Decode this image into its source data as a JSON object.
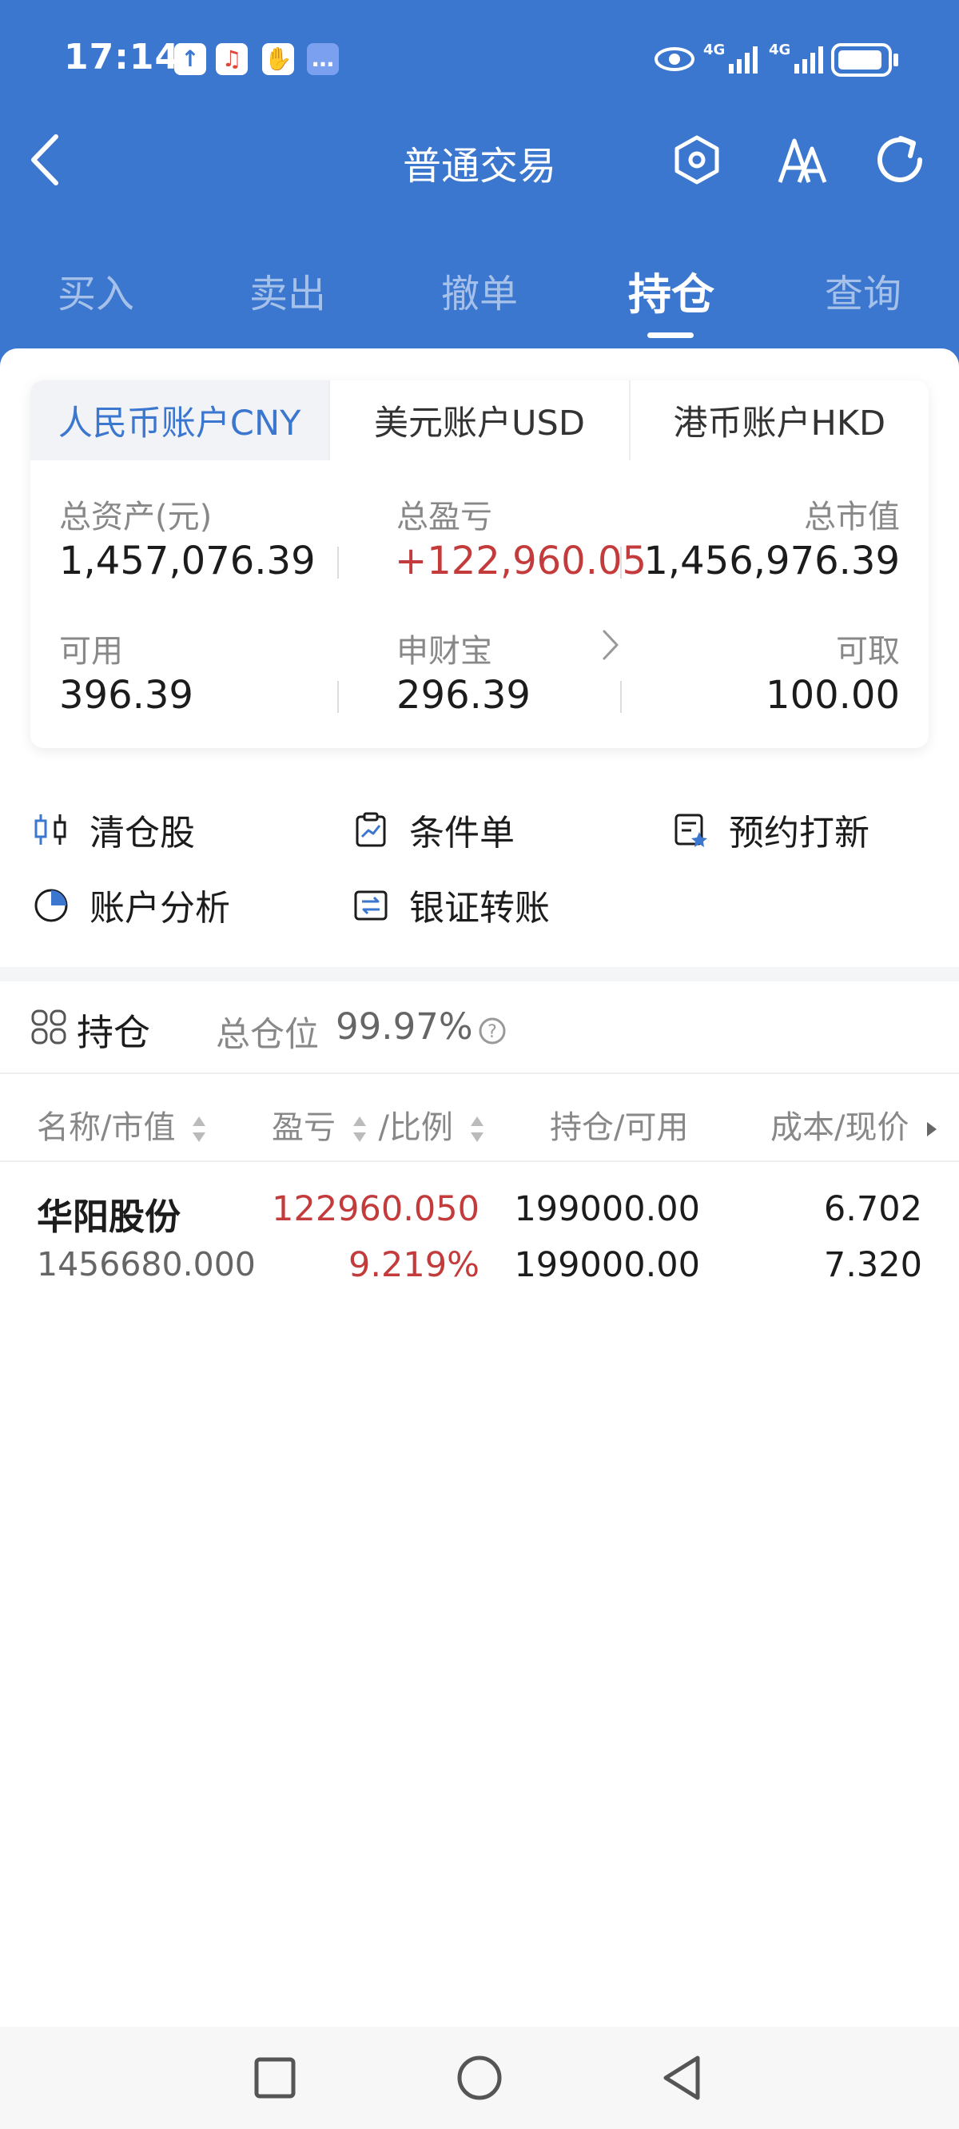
{
  "status_bar": {
    "time": "17:14"
  },
  "header": {
    "title": "普通交易"
  },
  "tabs": [
    {
      "label": "买入"
    },
    {
      "label": "卖出"
    },
    {
      "label": "撤单"
    },
    {
      "label": "持仓",
      "active": true
    },
    {
      "label": "查询"
    }
  ],
  "account_tabs": [
    {
      "label": "人民币账户CNY",
      "active": true
    },
    {
      "label": "美元账户USD"
    },
    {
      "label": "港币账户HKD"
    }
  ],
  "summary": {
    "total_assets_label": "总资产(元)",
    "total_assets": "1,457,076.39",
    "total_pnl_label": "总盈亏",
    "total_pnl": "+122,960.05",
    "market_value_label": "总市值",
    "market_value": "1,456,976.39",
    "available_label": "可用",
    "available": "396.39",
    "shencaibao_label": "申财宝",
    "shencaibao": "296.39",
    "withdrawable_label": "可取",
    "withdrawable": "100.00"
  },
  "features": [
    {
      "label": "清仓股",
      "icon": "candlestick-icon"
    },
    {
      "label": "条件单",
      "icon": "clipboard-chart-icon"
    },
    {
      "label": "预约打新",
      "icon": "reservation-doc-icon"
    },
    {
      "label": "账户分析",
      "icon": "pie-chart-icon"
    },
    {
      "label": "银证转账",
      "icon": "transfer-icon"
    }
  ],
  "positions": {
    "title": "持仓",
    "total_position_label": "总仓位",
    "total_position": "99.97%",
    "columns": [
      "名称/市值",
      "盈亏",
      "/比例",
      "持仓/可用",
      "成本/现价"
    ],
    "rows": [
      {
        "name": "华阳股份",
        "market_value": "1456680.000",
        "pnl": "122960.050",
        "ratio": "9.219%",
        "holding": "199000.00",
        "available": "199000.00",
        "cost": "6.702",
        "price": "7.320"
      }
    ]
  },
  "colors": {
    "primary": "#3b76cf",
    "profit": "#c33b3b"
  }
}
